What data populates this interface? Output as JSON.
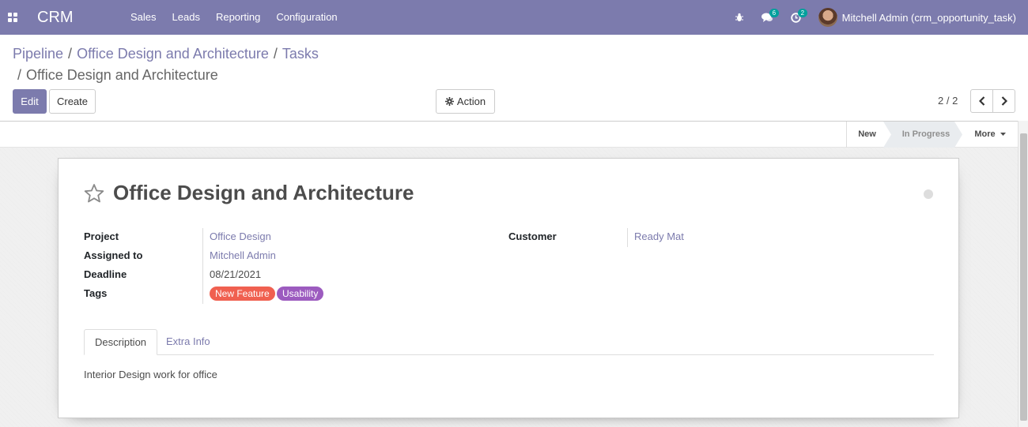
{
  "navbar": {
    "app_name": "CRM",
    "menu": [
      "Sales",
      "Leads",
      "Reporting",
      "Configuration"
    ],
    "messages_count": "6",
    "activities_count": "2",
    "user_name": "Mitchell Admin (crm_opportunity_task)"
  },
  "breadcrumb": {
    "items": [
      "Pipeline",
      "Office Design and Architecture",
      "Tasks"
    ],
    "current": "Office Design and Architecture",
    "separator": "/"
  },
  "buttons": {
    "edit": "Edit",
    "create": "Create",
    "action": "Action"
  },
  "pager": {
    "value": "2 / 2"
  },
  "stages": {
    "new": "New",
    "in_progress": "In Progress",
    "more": "More"
  },
  "record": {
    "title": "Office Design and Architecture",
    "fields": {
      "project_label": "Project",
      "project_value": "Office Design",
      "assigned_label": "Assigned to",
      "assigned_value": "Mitchell Admin",
      "deadline_label": "Deadline",
      "deadline_value": "08/21/2021",
      "tags_label": "Tags",
      "customer_label": "Customer",
      "customer_value": "Ready Mat"
    },
    "tags": [
      {
        "label": "New Feature",
        "color": "#f06050"
      },
      {
        "label": "Usability",
        "color": "#9c5bbf"
      }
    ],
    "tabs": {
      "description": "Description",
      "extra_info": "Extra Info"
    },
    "description": "Interior Design work for office"
  },
  "colors": {
    "brand": "#7c7bad",
    "badge": "#00a09d"
  }
}
